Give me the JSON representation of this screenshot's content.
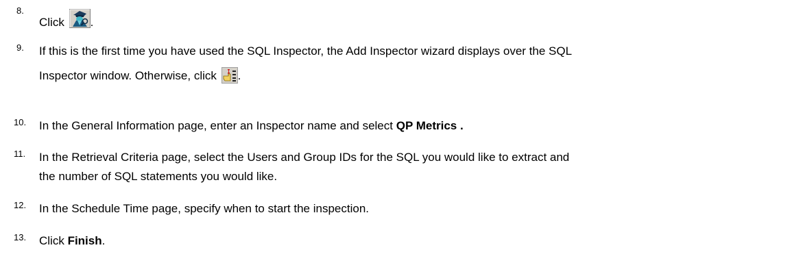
{
  "steps": [
    {
      "number": "8.",
      "text_before": "Click ",
      "icon": "sql-inspector-toolbar-icon",
      "text_after": "."
    },
    {
      "number": "9.",
      "line1": "If this is the first time you have used the SQL Inspector, the Add Inspector wizard displays over the SQL",
      "line2_before": "Inspector window. Otherwise, click ",
      "icon": "add-inspector-icon",
      "text_after": "."
    },
    {
      "number": "10.",
      "text_before": "In the General Information page, enter an Inspector name and select ",
      "bold": "QP Metrics",
      "text_after": " ."
    },
    {
      "number": "11.",
      "line1": "In the Retrieval Criteria page, select the Users and Group IDs for the SQL you would like to extract and",
      "line2": "the number of SQL statements you would like."
    },
    {
      "number": "12.",
      "text": "In the Schedule Time page, specify when to start the inspection."
    },
    {
      "number": "13.",
      "text_before": "Click ",
      "bold": "Finish",
      "text_after": "."
    }
  ]
}
